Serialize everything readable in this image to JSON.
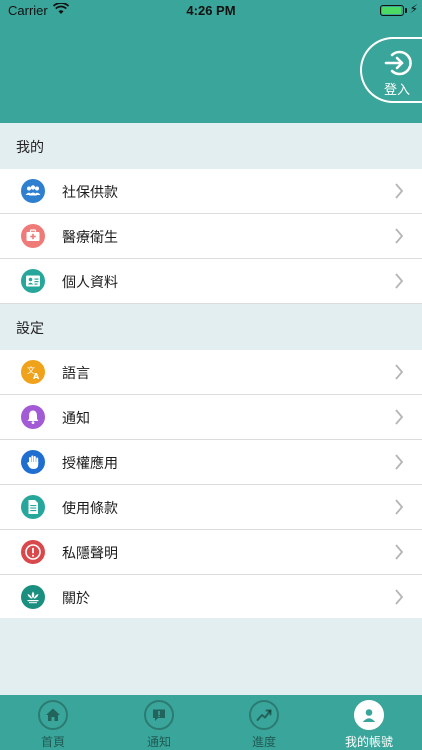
{
  "status_bar": {
    "carrier": "Carrier",
    "time": "4:26 PM",
    "battery_level": 0.95
  },
  "header": {
    "login_label": "登入"
  },
  "sections": [
    {
      "title": "我的",
      "items": [
        {
          "label": "社保供款",
          "icon": "people-icon",
          "color": "#2f7fd1"
        },
        {
          "label": "醫療衛生",
          "icon": "medical-kit-icon",
          "color": "#ef7b78"
        },
        {
          "label": "個人資料",
          "icon": "id-card-icon",
          "color": "#27a79b"
        }
      ]
    },
    {
      "title": "設定",
      "items": [
        {
          "label": "語言",
          "icon": "language-icon",
          "color": "#f0a21a"
        },
        {
          "label": "通知",
          "icon": "bell-icon",
          "color": "#a25bd4"
        },
        {
          "label": "授權應用",
          "icon": "hand-icon",
          "color": "#1f6fd0"
        },
        {
          "label": "使用條款",
          "icon": "document-icon",
          "color": "#27a79b"
        },
        {
          "label": "私隱聲明",
          "icon": "alert-icon",
          "color": "#d9484a"
        },
        {
          "label": "關於",
          "icon": "lotus-icon",
          "color": "#1a8f7f"
        }
      ]
    }
  ],
  "tabs": [
    {
      "label": "首頁",
      "icon": "home-icon",
      "active": false
    },
    {
      "label": "通知",
      "icon": "message-icon",
      "active": false
    },
    {
      "label": "進度",
      "icon": "trend-icon",
      "active": false
    },
    {
      "label": "我的帳號",
      "icon": "user-icon",
      "active": true
    }
  ],
  "colors": {
    "primary": "#3aa59a",
    "background": "#e3eef0"
  }
}
